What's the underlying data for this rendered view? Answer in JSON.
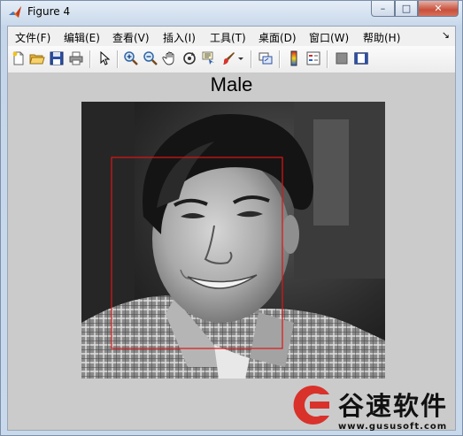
{
  "window": {
    "title": "Figure 4",
    "controls": {
      "minimize": "–",
      "maximize": "□",
      "close": "✕"
    }
  },
  "menubar": {
    "items": [
      {
        "label": "文件(F)"
      },
      {
        "label": "编辑(E)"
      },
      {
        "label": "查看(V)"
      },
      {
        "label": "插入(I)"
      },
      {
        "label": "工具(T)"
      },
      {
        "label": "桌面(D)"
      },
      {
        "label": "窗口(W)"
      },
      {
        "label": "帮助(H)"
      }
    ],
    "overflow_glyph": "↘"
  },
  "toolbar": {
    "buttons": [
      "new-figure-icon",
      "open-file-icon",
      "save-icon",
      "print-icon",
      "edit-plot-arrow-icon",
      "zoom-in-icon",
      "zoom-out-icon",
      "pan-hand-icon",
      "rotate-3d-icon",
      "data-cursor-icon",
      "brush-icon",
      "link-plot-icon",
      "colorbar-icon",
      "legend-icon",
      "hide-plot-tools-icon",
      "show-plot-tools-icon"
    ]
  },
  "figure": {
    "axes_title": "Male",
    "detection_box_color": "#e01414",
    "background_color": "#cbcbcb"
  },
  "watermark": {
    "brand": "谷速软件",
    "url": "www.gususoft.com",
    "accent_color": "#d9322b"
  }
}
